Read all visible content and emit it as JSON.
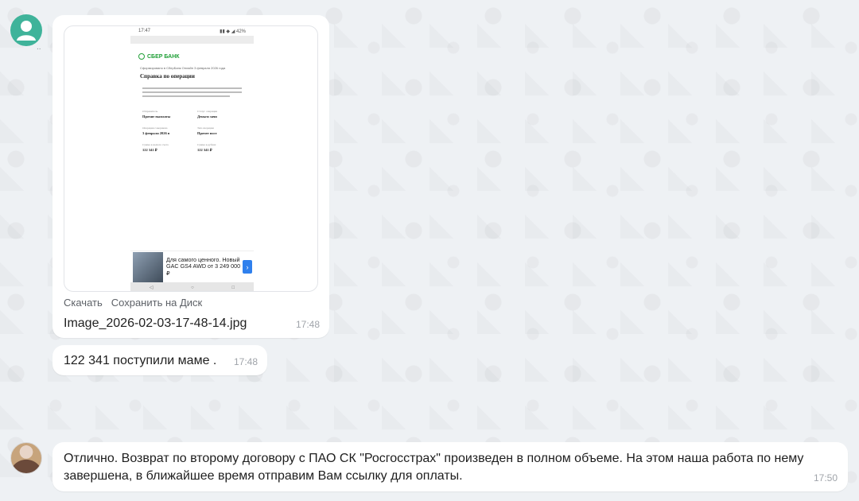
{
  "attachment": {
    "preview": {
      "status_time": "17:47",
      "status_icons": "▮▮ ◆ ◢ 42%",
      "bank_name": "СБЕР БАНК",
      "doc_small_text": "Сформировано в СберБанк Онлайн 3 февраля 2026 года",
      "doc_title": "Справка по операции",
      "fields": [
        {
          "label": "Отправитель",
          "value": "Прочие выплаты"
        },
        {
          "label": "Статус операции",
          "value": "Деньги зачи"
        },
        {
          "label": "Операция совершена",
          "value": "3 февраля 2026 в"
        },
        {
          "label": "Тип операции",
          "value": "Прочее пост"
        },
        {
          "label": "Сумма в валюте счета",
          "value": "122 341 ₽"
        },
        {
          "label": "Сумма в рублях",
          "value": "122 341 ₽"
        }
      ],
      "ad_text": "Для самого ценного. Новый GAC GS4 AWD от 3 249 000 ₽",
      "ad_arrow": "›",
      "nav_back": "◁",
      "nav_home": "○",
      "nav_recent": "□"
    },
    "download_label": "Скачать",
    "save_label": "Сохранить на Диск",
    "file_name": "Image_2026-02-03-17-48-14.jpg",
    "time": "17:48"
  },
  "message1": {
    "text": "122 341 поступили маме .",
    "time": "17:48"
  },
  "message2": {
    "text": "Отлично. Возврат по второму договору с ПАО СК \"Росгосстрах\" произведен в полном объеме. На этом наша работа по нему завершена, в ближайшее время отправим Вам ссылку для оплаты.",
    "time": "17:50"
  },
  "avatar1_dots": "..",
  "colors": {
    "background": "#eef1f4",
    "avatar_teal": "#3fb39a",
    "sber_green": "#21a038",
    "timestamp": "#a0a4aa"
  }
}
